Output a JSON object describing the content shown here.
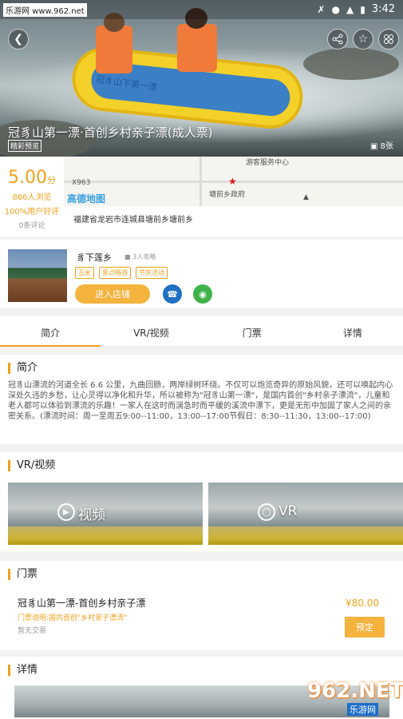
{
  "status_bar": {
    "watermark": "乐游网 www.962.net",
    "time": "3:42"
  },
  "hero": {
    "title": "冠豸山第一漂·首创乡村亲子漂(成人票)",
    "sub": "精彩预览",
    "photo_count": "8张",
    "raft_text": "冠豸山下第一漂"
  },
  "rating": {
    "score": "5.00",
    "score_unit": "分",
    "views": "866人浏览",
    "positive": "100%用户好评",
    "comments": "0条评论"
  },
  "map": {
    "label_x963": "X963",
    "label_center": "游客服务中心",
    "label_gov": "塘前乡政府",
    "amap_logo": "高德地图"
  },
  "address": "福建省龙岩市连城县塘前乡塘前乡",
  "shop": {
    "name": "豸下莲乡",
    "tour_count": "3人攻略",
    "tags": [
      "玉米",
      "景点畅游",
      "节庆活动"
    ],
    "enter_button": "进入店铺"
  },
  "tabs": [
    "简介",
    "VR/视频",
    "门票",
    "详情"
  ],
  "intro": {
    "title": "简介",
    "text": "冠豸山漂流的河道全长 6.6 公里，九曲回肠，两岸绿树环绕。不仅可以饱览奇异的原始风貌，还可以唤起内心深处久违的乡愁，让心灵得以净化和升华，所以被称为\"冠豸山第一漂\"，是国内首创\"乡村亲子漂流\"，儿童和老人都可以体验到漂流的乐趣！一家人在这时而湍急时而平缓的溪流中漂下，更是无形中加固了家人之间的亲密关系。(漂流时间：周一至周五9:00--11:00，13:00--17:00节假日：8:30--11:30，13:00--17:00)"
  },
  "vr": {
    "title": "VR/视频",
    "video_label": "视频",
    "vr_label": "VR"
  },
  "ticket": {
    "title": "门票",
    "name": "冠豸山第一漂-首创乡村亲子漂",
    "note": "门票说明:国内首创\"乡村亲子漂流\"",
    "trade": "暂无交易",
    "price": "¥80.00",
    "book_button": "预定"
  },
  "detail": {
    "title": "详情"
  },
  "watermark_bottom": {
    "big": "962.NET",
    "small": "乐游网"
  },
  "colors": {
    "accent": "#f0a11c",
    "phone": "#1f6fc2",
    "wechat": "#3fb34a"
  }
}
